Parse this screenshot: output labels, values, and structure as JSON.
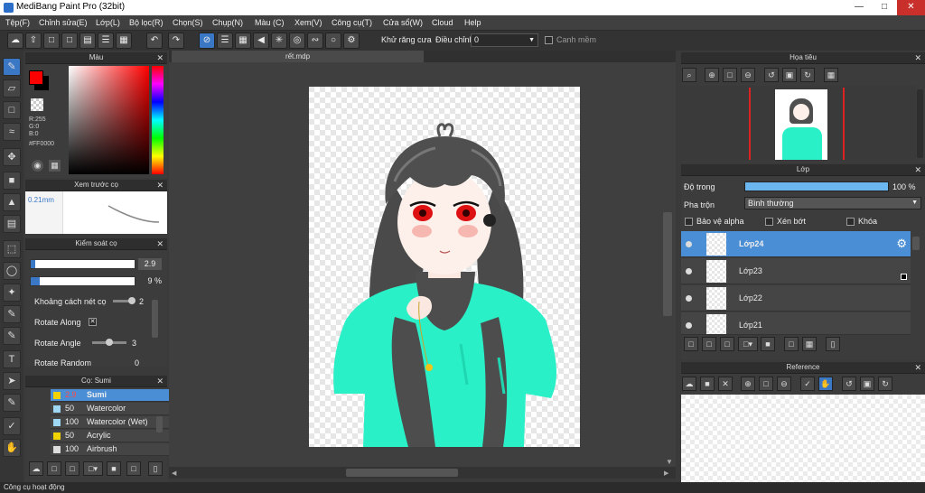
{
  "window": {
    "title": "MediBang Paint Pro (32bit)"
  },
  "menu": [
    "Tệp(F)",
    "Chỉnh sửa(E)",
    "Lớp(L)",
    "Bộ lọc(R)",
    "Chọn(S)",
    "Chụp(N)",
    "Màu (C)",
    "Xem(V)",
    "Công cụ(T)",
    "Cửa sổ(W)",
    "Cloud",
    "Help"
  ],
  "toolbar": {
    "antialias_label": "Khử răng cưa",
    "adjust_label": "Điều chỉnh",
    "adjust_value": "0",
    "edge_label": "Canh mềm"
  },
  "color_panel": {
    "title": "Màu",
    "r": "R:255",
    "g": "G:0",
    "b": "B:0",
    "hex": "#FF0000",
    "primary_color": "#ff0000"
  },
  "brush_preview": {
    "title": "Xem trước cọ",
    "size": "0.21mm"
  },
  "brush_control": {
    "title": "Kiểm soát cọ",
    "size_value": "2.9",
    "opacity_value": "9 %",
    "rows": [
      {
        "label": "Khoảng cách nét cọ",
        "value": "2"
      },
      {
        "label": "Rotate Along",
        "value": ""
      },
      {
        "label": "Rotate Angle",
        "value": "3"
      },
      {
        "label": "Rotate Random",
        "value": "0"
      }
    ]
  },
  "brush_list": {
    "title": "Cọ: Sumi",
    "items": [
      {
        "size": "2.9",
        "name": "Sumi",
        "color": "#f2d200"
      },
      {
        "size": "50",
        "name": "Watercolor",
        "color": "#9fd8f5"
      },
      {
        "size": "100",
        "name": "Watercolor (Wet)",
        "color": "#9fd8f5"
      },
      {
        "size": "50",
        "name": "Acrylic",
        "color": "#f2d200"
      },
      {
        "size": "100",
        "name": "Airbrush",
        "color": "#dddddd"
      }
    ]
  },
  "document": {
    "tab": "rết.mdp"
  },
  "navigator": {
    "title": "Họa tiêu"
  },
  "layer_panel": {
    "title": "Lớp",
    "opacity_label": "Độ trong",
    "opacity_value": "100 %",
    "opacity_fraction": 1.0,
    "blend_label": "Pha trộn",
    "blend_value": "Bình thường",
    "protect_alpha": "Bảo vệ alpha",
    "clipping": "Xén bớt",
    "lock": "Khóa",
    "layers": [
      {
        "name": "Lớp24"
      },
      {
        "name": "Lớp23"
      },
      {
        "name": "Lớp22"
      },
      {
        "name": "Lớp21"
      }
    ]
  },
  "reference": {
    "title": "Reference"
  },
  "status": {
    "text": "Công cụ hoạt động"
  }
}
